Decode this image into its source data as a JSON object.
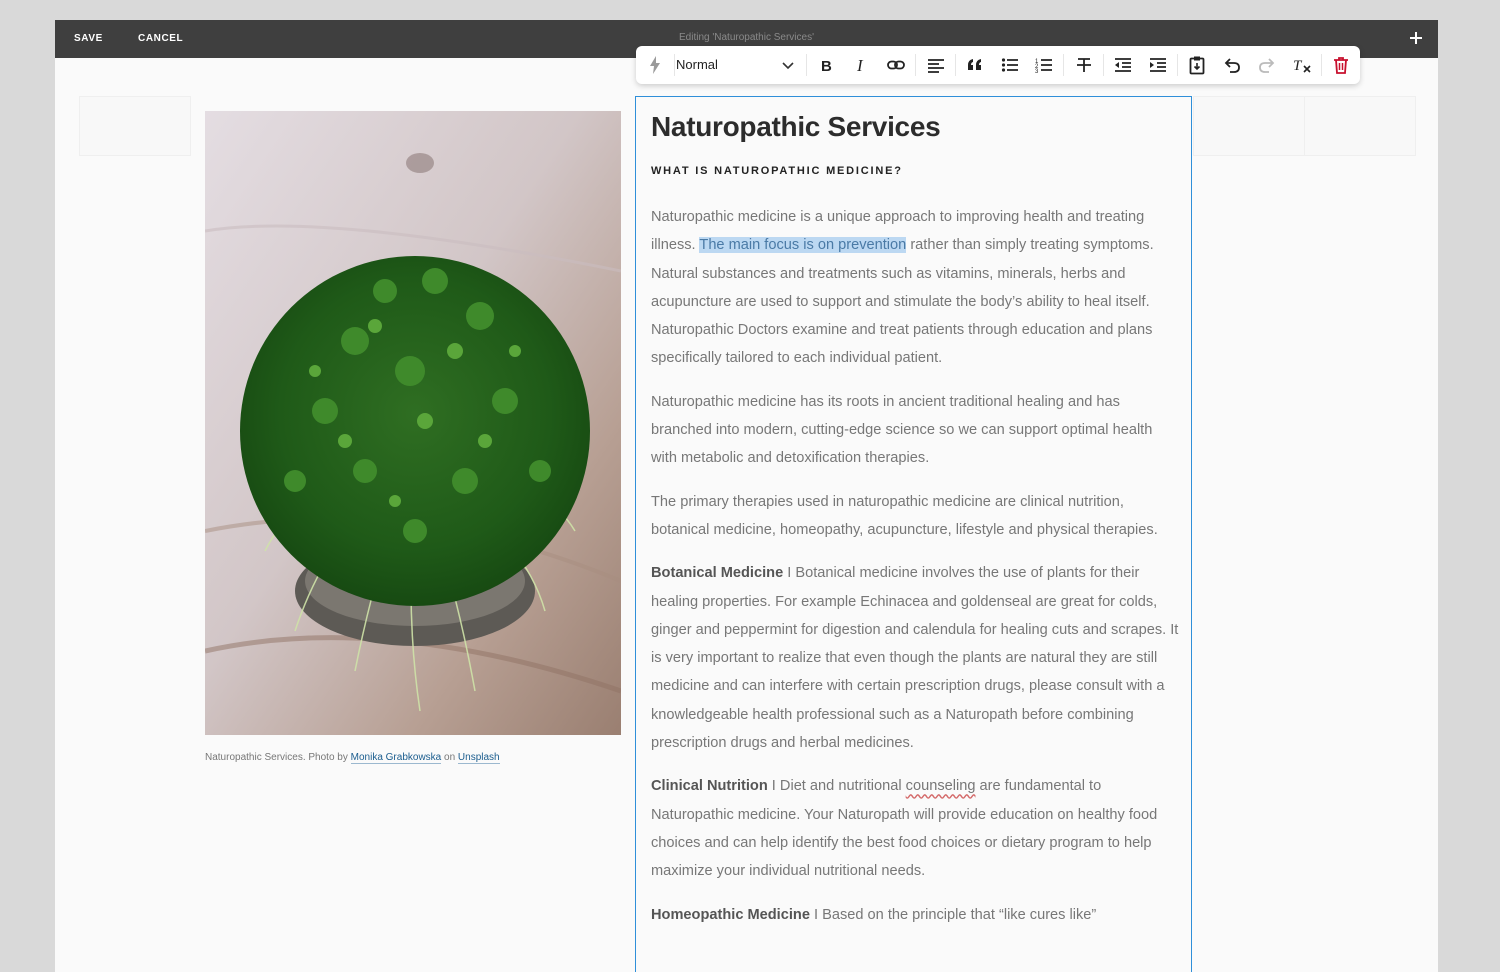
{
  "topbar": {
    "save_label": "SAVE",
    "cancel_label": "CANCEL",
    "editing_title": "Editing 'Naturopathic Services'"
  },
  "toolbar": {
    "block_style": "Normal",
    "icons": [
      "lightning-icon",
      "bold-icon",
      "italic-icon",
      "link-icon",
      "align-left-icon",
      "blockquote-icon",
      "bullet-list-icon",
      "numbered-list-icon",
      "strikethrough-icon",
      "outdent-icon",
      "indent-icon",
      "paste-icon",
      "undo-icon",
      "redo-icon",
      "clear-format-icon",
      "delete-icon"
    ],
    "delete_color": "#c8102e"
  },
  "image": {
    "caption_prefix": "Naturopathic Services. Photo by",
    "caption_author": "Monika Grabkowska",
    "caption_on": "on",
    "caption_source": "Unsplash"
  },
  "editor": {
    "title": "Naturopathic Services",
    "subtitle": "WHAT IS NATUROPATHIC MEDICINE?",
    "p1_before": "Naturopathic medicine is a unique approach to improving health and treating illness. ",
    "p1_highlight": "The main focus is on prevention",
    "p1_after": " rather than simply treating symptoms. Natural substances and treatments such as vitamins, minerals, herbs and acupuncture are used to support and stimulate the body’s ability to heal itself. Naturopathic Doctors examine and treat patients through education and plans specifically tailored to each individual patient.",
    "p2": "Naturopathic medicine has its roots in ancient traditional healing and has branched into modern, cutting-edge science so we can support optimal health with metabolic and detoxification therapies.",
    "p3": "The primary therapies used in naturopathic medicine are clinical nutrition, botanical medicine, homeopathy, acupuncture, lifestyle and physical therapies.",
    "p4_bold": "Botanical Medicine",
    "p4_text": " I Botanical medicine involves the use of plants for their healing properties. For example Echinacea and goldenseal are great for colds, ginger and peppermint for digestion and calendula for healing cuts and scrapes. It is very important to realize that even though the plants are natural they are still medicine and can interfere with certain prescription drugs, please consult with a knowledgeable health professional such as a Naturopath before combining prescription drugs and herbal medicines.",
    "p5_bold": "Clinical Nutrition",
    "p5_before": " I Diet and nutritional ",
    "p5_misspelled": "counseling",
    "p5_after": " are fundamental to Naturopathic medicine. Your Naturopath will provide education on healthy food choices and can help identify the best food choices or dietary program to help maximize your individual nutritional needs.",
    "p6_bold": "Homeopathic Medicine",
    "p6_text": " I Based on the principle that “like cures like”"
  },
  "colors": {
    "accent": "#2f8fd9",
    "topbar": "#3f3f3f",
    "highlight": "#bcd8f2"
  }
}
